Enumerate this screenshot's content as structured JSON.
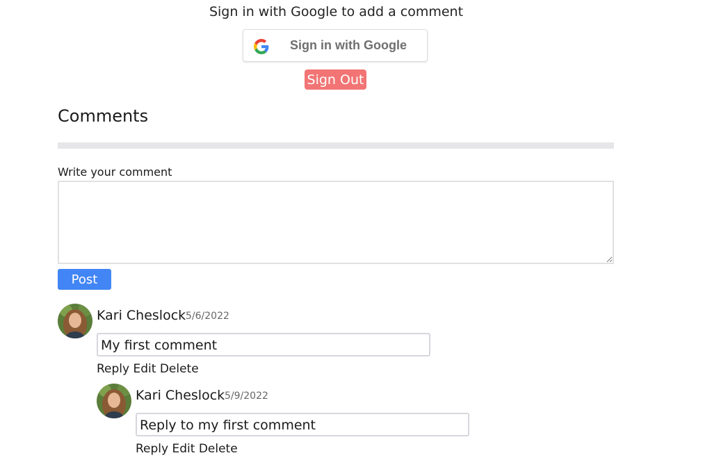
{
  "auth": {
    "prompt": "Sign in with Google to add a comment",
    "google_button_label": "Sign in with Google",
    "google_icon": "google-g-logo",
    "sign_out_label": "Sign Out",
    "sign_out_color": "#f27474"
  },
  "comments_section": {
    "title": "Comments",
    "field_label": "Write your comment",
    "textarea_value": "",
    "post_label": "Post",
    "post_color": "#4285f4"
  },
  "comments": [
    {
      "author": "Kari Cheslock",
      "date": "5/6/2022",
      "text": "My first comment",
      "actions": [
        "Reply",
        "Edit",
        "Delete"
      ],
      "replies": [
        {
          "author": "Kari Cheslock",
          "date": "5/9/2022",
          "text": "Reply to my first comment",
          "actions": [
            "Reply",
            "Edit",
            "Delete"
          ]
        }
      ]
    }
  ]
}
